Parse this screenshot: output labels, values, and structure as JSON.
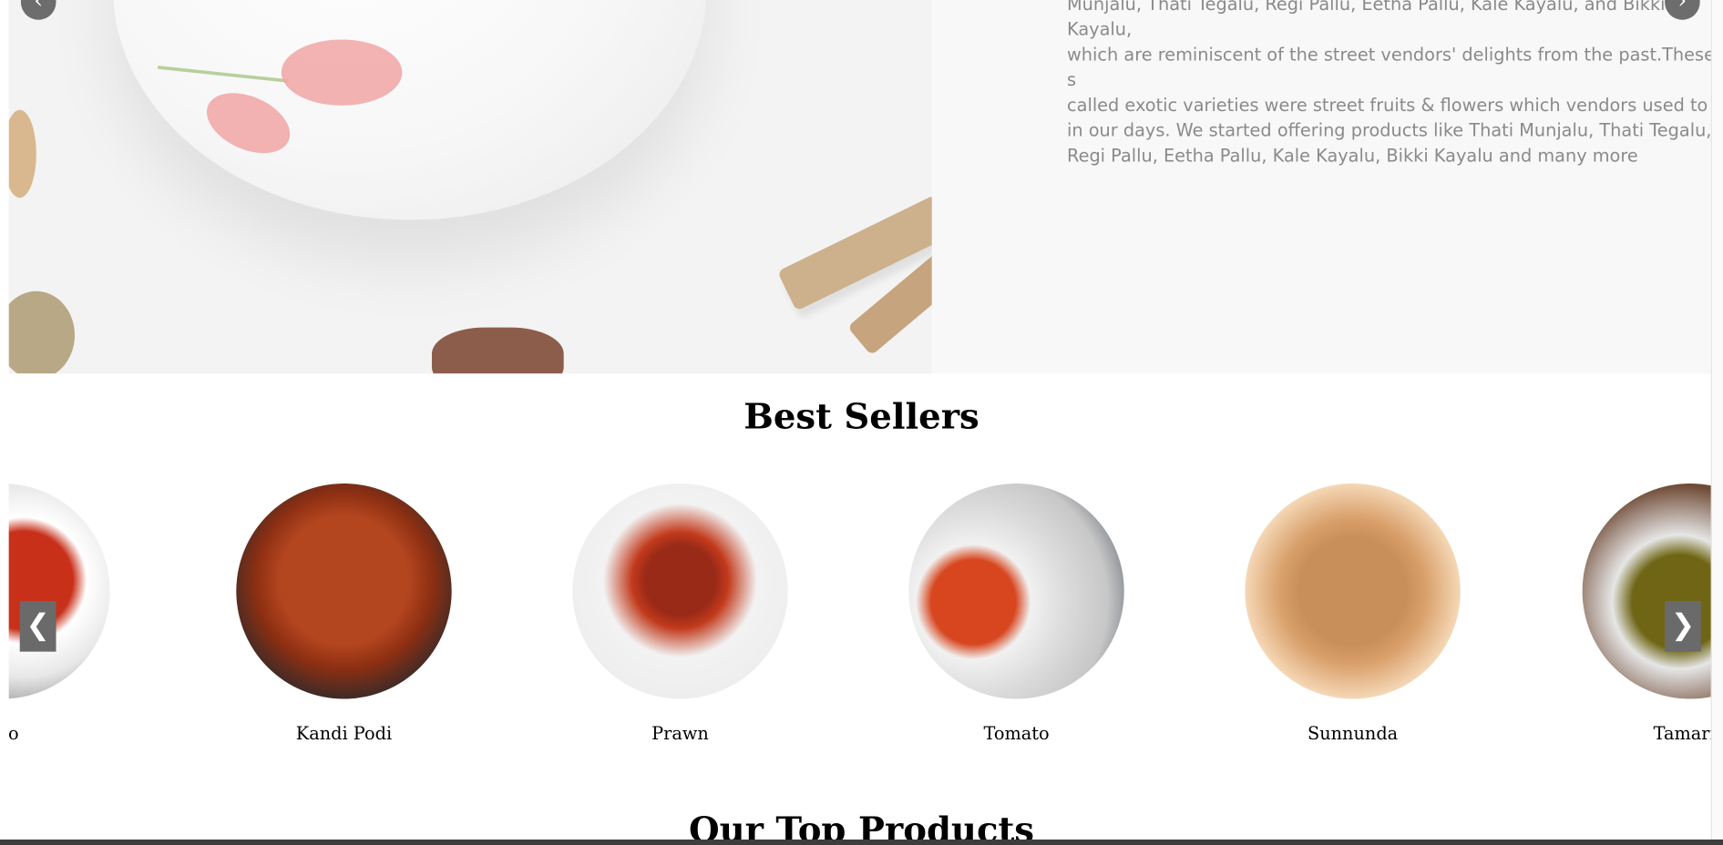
{
  "hero": {
    "text": "Munjalu, Thati Tegalu, Regi Pallu, Eetha Pallu, Kale Kayalu, and Bikki Kayalu,\nwhich are reminiscent of the street vendors' delights from the past.These s\ncalled exotic varieties were street fruits & flowers which vendors used to s\nin our days. We started offering products like Thati Munjalu, Thati Tegalu,\nRegi Pallu, Eetha Pallu, Kale Kayalu, Bikki Kayalu and many more",
    "prev_icon": "‹",
    "next_icon": "›"
  },
  "best_sellers": {
    "title": "Best Sellers",
    "prev_icon": "❮",
    "next_icon": "❯",
    "items": [
      {
        "name": "ngo",
        "image": "mango"
      },
      {
        "name": "Kandi Podi",
        "image": "chilli-powder"
      },
      {
        "name": "Prawn",
        "image": "prawn"
      },
      {
        "name": "Tomato",
        "image": "tomato"
      },
      {
        "name": "Sunnunda",
        "image": "sunnunda"
      },
      {
        "name": "Tamarin",
        "image": "tamarind"
      }
    ]
  },
  "top_products": {
    "title": "Our Top Products"
  }
}
